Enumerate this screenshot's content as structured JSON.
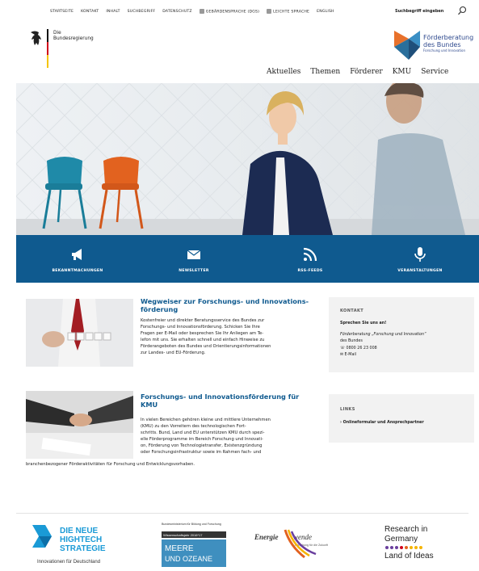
{
  "topnav": {
    "items": [
      "Startseite",
      "Kontakt",
      "Inhalt",
      "Suchbegriff",
      "Datenschutz",
      "Gebärdensprache (DGS)",
      "Leichte Sprache",
      "English"
    ]
  },
  "search": {
    "value": "Suchbegriff eingeben"
  },
  "header": {
    "bund_line1": "Die",
    "bund_line2": "Bundesregierung",
    "fb_line1": "Förderberatung",
    "fb_line2": "des Bundes",
    "fb_line3": "Forschung und Innovation"
  },
  "mainnav": {
    "items": [
      "Aktuelles",
      "Themen",
      "Förderer",
      "KMU",
      "Service"
    ]
  },
  "iconband": {
    "items": [
      {
        "label": "Bekanntmachungen",
        "icon": "megaphone-icon"
      },
      {
        "label": "Newsletter",
        "icon": "envelope-icon"
      },
      {
        "label": "RSS-Feeds",
        "icon": "rss-icon"
      },
      {
        "label": "Veranstaltungen",
        "icon": "microphone-icon"
      }
    ]
  },
  "articles": [
    {
      "title": "Wegweiser zur Forschungs- und Innovations-förderung",
      "lines": [
        "Kostenfreier und direkter Beratungsservice des Bundes zur",
        "Forschungs- und Innovationsförderung. Schicken Sie Ihre",
        "Fragen per E-Mail oder besprechen Sie Ihr Anliegen am Te-",
        "lefon mit uns. Sie erhalten schnell und einfach Hinweise zu",
        "Förderangeboten des Bundes und Orientierungsinformationen",
        "zur Landes- und EU-Förderung."
      ]
    },
    {
      "title": "Forschungs- und Innovationsförderung für KMU",
      "lines": [
        "In vielen Bereichen gehören kleine und mittlere Unternehmen",
        "(KMU) zu den Vorreitern des technologischen Fort-",
        "schritts. Bund, Land und EU unterstützen KMU durch spezi-",
        "elle Förderprogramme im Bereich Forschung und Innovati-",
        "on, Förderung von Technologietransfer, Existenzgründung",
        "oder Forschungsinfrastruktur sowie im Rahmen fach- und",
        "branchenbezogener Förderaktivitäten für Forschung und Entwicklungsvorhaben."
      ]
    }
  ],
  "kontakt": {
    "title": "Kontakt",
    "line1": "Sprechen Sie uns an!",
    "line2": "Förderberatung „Forschung und Innovation“",
    "line3": "des Bundes",
    "phone": "0800 26 23 008",
    "email": "E-Mail"
  },
  "links": {
    "title": "Links",
    "item1": "Onlineformular und Ansprechpartner"
  },
  "partners": {
    "hightech_line1": "DIE NEUE",
    "hightech_line2": "HIGHTECH",
    "hightech_line3": "STRATEGIE",
    "hightech_sub": "Innovationen für Deutschland",
    "meere_top": "Bundesministerium für Bildung und Forschung",
    "meere_band": "Wissenschaftsjahr 2016*17",
    "meere_line1": "MEERE",
    "meere_line2": "UND OZEANE",
    "energie_a": "Energie",
    "energie_b": "wende",
    "energie_sub": "Forschung für die Zukunft",
    "research_line1": "Research in",
    "research_line2": "Germany",
    "research_line3": "Land of Ideas"
  },
  "colors": {
    "band": "#0f5a8f",
    "title": "#0f5a8f",
    "box": "#f2f2f2"
  }
}
